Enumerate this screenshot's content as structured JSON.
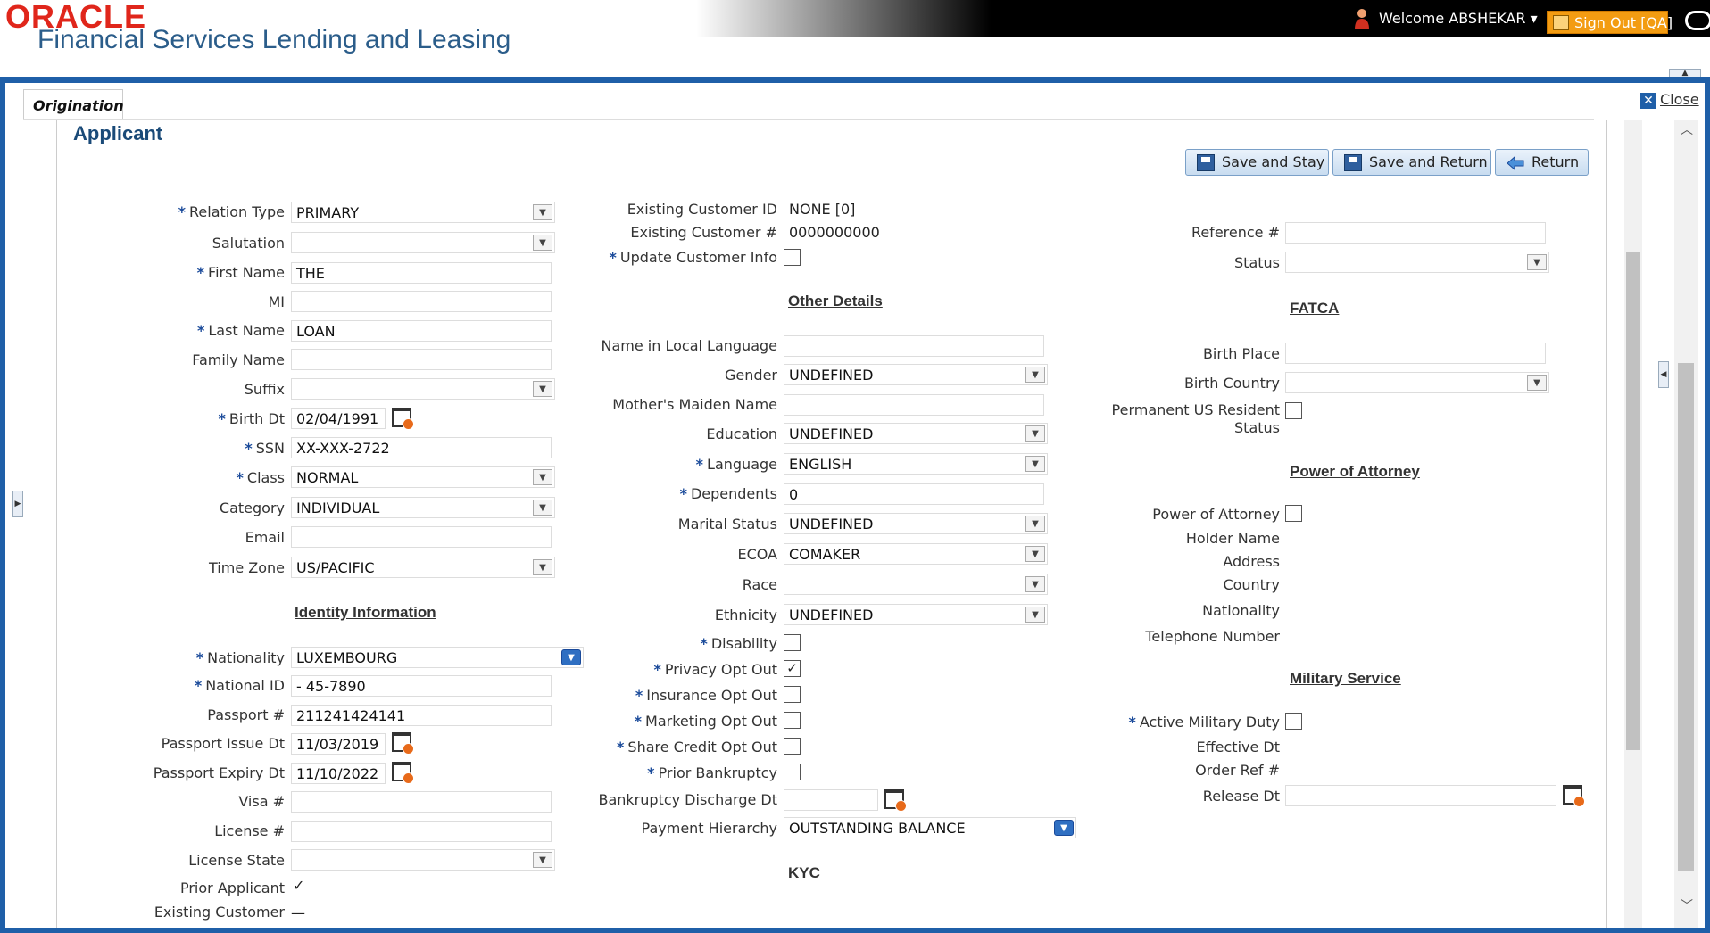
{
  "header": {
    "logo_brand": "ORACLE",
    "product_name": "Financial Services Lending and Leasing",
    "welcome": "Welcome ABSHEKAR ▾",
    "sign_out": "Sign Out [QA]"
  },
  "tab": {
    "label": "Origination",
    "close": "Close"
  },
  "page": {
    "title": "Applicant"
  },
  "toolbar": {
    "save_stay": "Save and Stay",
    "save_return": "Save and Return",
    "return": "Return"
  },
  "col1": {
    "relation_type": {
      "label": "Relation Type",
      "value": "PRIMARY"
    },
    "salutation": {
      "label": "Salutation",
      "value": ""
    },
    "first_name": {
      "label": "First Name",
      "value": "THE"
    },
    "mi": {
      "label": "MI",
      "value": ""
    },
    "last_name": {
      "label": "Last Name",
      "value": "LOAN"
    },
    "family_name": {
      "label": "Family Name",
      "value": ""
    },
    "suffix": {
      "label": "Suffix",
      "value": ""
    },
    "birth_dt": {
      "label": "Birth Dt",
      "value": "02/04/1991"
    },
    "ssn": {
      "label": "SSN",
      "value": "XX-XXX-2722"
    },
    "class": {
      "label": "Class",
      "value": "NORMAL"
    },
    "category": {
      "label": "Category",
      "value": "INDIVIDUAL"
    },
    "email": {
      "label": "Email",
      "value": ""
    },
    "time_zone": {
      "label": "Time Zone",
      "value": "US/PACIFIC"
    },
    "identity_heading": "Identity Information",
    "nationality": {
      "label": "Nationality",
      "value": "LUXEMBOURG"
    },
    "national_id": {
      "label": "National ID",
      "value": "- 45-7890"
    },
    "passport": {
      "label": "Passport #",
      "value": "211241424141"
    },
    "passport_issue": {
      "label": "Passport Issue Dt",
      "value": "11/03/2019"
    },
    "passport_expiry": {
      "label": "Passport Expiry Dt",
      "value": "11/10/2022"
    },
    "visa": {
      "label": "Visa #",
      "value": ""
    },
    "license": {
      "label": "License #",
      "value": ""
    },
    "license_state": {
      "label": "License State",
      "value": ""
    },
    "prior_applicant": {
      "label": "Prior Applicant",
      "value": "✓"
    },
    "existing_customer": {
      "label": "Existing Customer",
      "value": "—"
    }
  },
  "col2": {
    "existing_customer_id": {
      "label": "Existing Customer ID",
      "value": "NONE [0]"
    },
    "existing_customer_no": {
      "label": "Existing Customer #",
      "value": "0000000000"
    },
    "update_customer_info": {
      "label": "Update Customer Info",
      "checked": false
    },
    "other_heading": "Other Details",
    "name_local": {
      "label": "Name in Local Language",
      "value": ""
    },
    "gender": {
      "label": "Gender",
      "value": "UNDEFINED"
    },
    "maiden_name": {
      "label": "Mother's Maiden Name",
      "value": ""
    },
    "education": {
      "label": "Education",
      "value": "UNDEFINED"
    },
    "language": {
      "label": "Language",
      "value": "ENGLISH"
    },
    "dependents": {
      "label": "Dependents",
      "value": "0"
    },
    "marital_status": {
      "label": "Marital Status",
      "value": "UNDEFINED"
    },
    "ecoa": {
      "label": "ECOA",
      "value": "COMAKER"
    },
    "race": {
      "label": "Race",
      "value": ""
    },
    "ethnicity": {
      "label": "Ethnicity",
      "value": "UNDEFINED"
    },
    "disability": {
      "label": "Disability",
      "checked": false
    },
    "privacy_opt_out": {
      "label": "Privacy Opt Out",
      "checked": true
    },
    "insurance_opt_out": {
      "label": "Insurance Opt Out",
      "checked": false
    },
    "marketing_opt_out": {
      "label": "Marketing Opt Out",
      "checked": false
    },
    "share_credit_opt_out": {
      "label": "Share Credit Opt Out",
      "checked": false
    },
    "prior_bankruptcy": {
      "label": "Prior Bankruptcy",
      "checked": false
    },
    "bankruptcy_discharge": {
      "label": "Bankruptcy Discharge Dt",
      "value": ""
    },
    "payment_hierarchy": {
      "label": "Payment Hierarchy",
      "value": "OUTSTANDING BALANCE"
    },
    "kyc_heading": "KYC"
  },
  "col3": {
    "reference": {
      "label": "Reference #",
      "value": ""
    },
    "status": {
      "label": "Status",
      "value": ""
    },
    "fatca_heading": "FATCA",
    "birth_place": {
      "label": "Birth Place",
      "value": ""
    },
    "birth_country": {
      "label": "Birth Country",
      "value": ""
    },
    "perm_us_resident": {
      "label1": "Permanent US Resident",
      "label2": "Status",
      "checked": false
    },
    "poa_heading": "Power of Attorney",
    "power_of_attorney": {
      "label": "Power of Attorney",
      "checked": false
    },
    "holder_name": {
      "label": "Holder Name"
    },
    "address": {
      "label": "Address"
    },
    "country": {
      "label": "Country"
    },
    "nationality": {
      "label": "Nationality"
    },
    "telephone": {
      "label": "Telephone Number"
    },
    "military_heading": "Military Service",
    "active_military": {
      "label": "Active Military Duty",
      "checked": false
    },
    "effective_dt": {
      "label": "Effective Dt"
    },
    "order_ref": {
      "label": "Order Ref #"
    },
    "release_dt": {
      "label": "Release Dt",
      "value": ""
    }
  },
  "colors": {
    "accent": "#1f5fa8",
    "brand_red": "#e0261b",
    "sign_out": "#f39c12",
    "required_asterisk": "#1a4a9a"
  }
}
